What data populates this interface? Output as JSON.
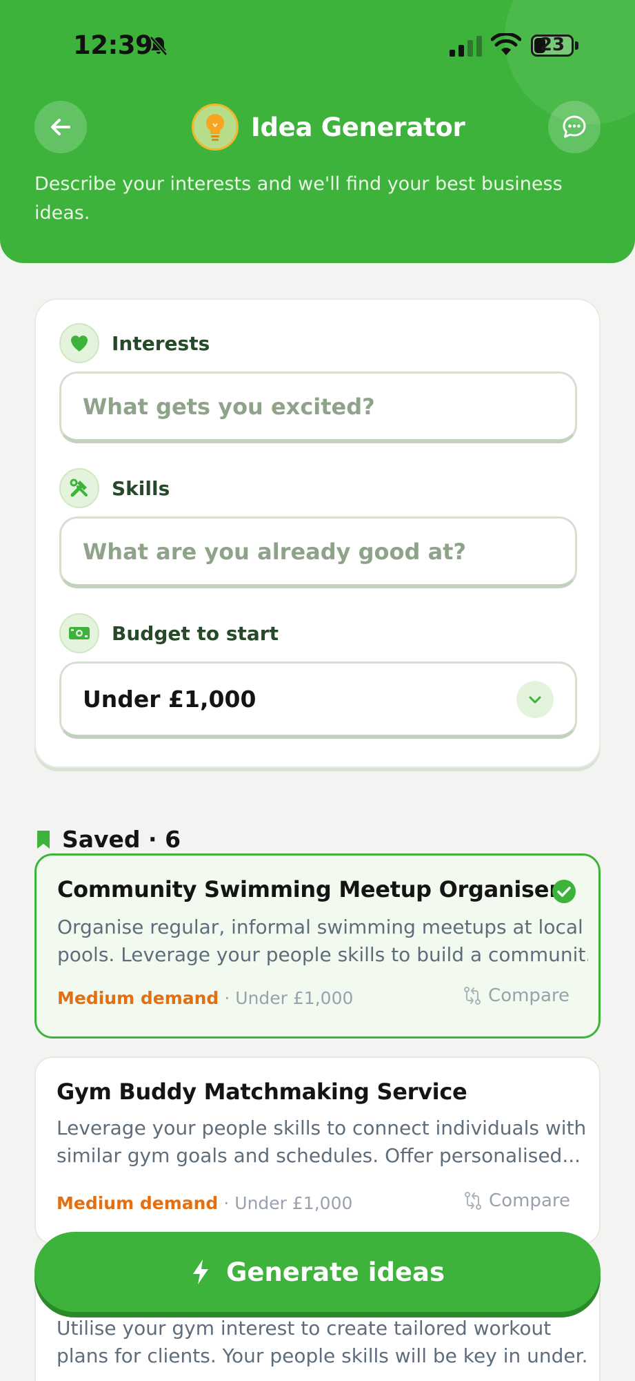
{
  "status_bar": {
    "time": "12:39",
    "battery_level": "23"
  },
  "header": {
    "title": "Idea Generator",
    "subtitle": "Describe your interests and we'll find your best business ideas.",
    "accent_color": "#3db33c"
  },
  "form": {
    "interests": {
      "label": "Interests",
      "placeholder": "What gets you excited?",
      "icon": "heart-icon"
    },
    "skills": {
      "label": "Skills",
      "placeholder": "What are you already good at?",
      "icon": "tools-icon"
    },
    "budget": {
      "label": "Budget to start",
      "value": "Under £1,000",
      "icon": "money-icon"
    }
  },
  "saved": {
    "title": "Saved · 6",
    "ideas": [
      {
        "title": "Community Swimming Meetup Organiser",
        "description_lines": [
          "Organise regular, informal swimming meetups at local",
          "pools. Leverage your people skills to build a communit..."
        ],
        "demand": "Medium demand",
        "separator": "·",
        "budget": "Under £1,000",
        "compare_label": "Compare",
        "selected": true
      },
      {
        "title": "Gym Buddy Matchmaking Service",
        "description_lines": [
          "Leverage your people skills to connect individuals with",
          "similar gym goals and schedules. Offer personalised..."
        ],
        "demand": "Medium demand",
        "separator": "·",
        "budget": "Under £1,000",
        "compare_label": "Compare",
        "selected": false
      },
      {
        "description_lines": [
          "Utilise your gym interest to create tailored workout",
          "plans for clients. Your people skills will be key in under..."
        ]
      }
    ]
  },
  "actions": {
    "generate_label": "Generate ideas"
  }
}
